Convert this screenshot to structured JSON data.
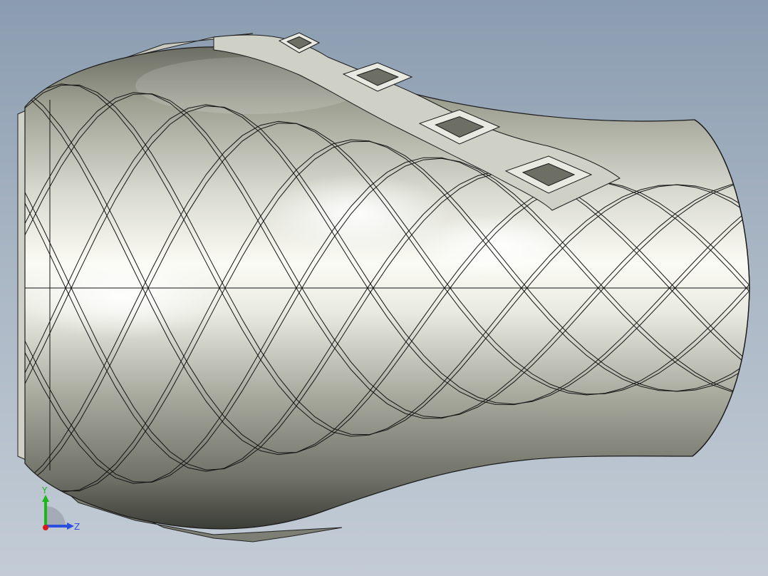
{
  "viewport": {
    "background_top": "#8a9cb0",
    "background_bottom": "#c3ccd6"
  },
  "model": {
    "surface_light": "#f4f5ee",
    "surface_mid": "#b7b9ad",
    "surface_dark": "#43453e",
    "edge_color": "#1a1a1a",
    "boss_count": 4
  },
  "triad": {
    "y_label": "Y",
    "z_label": "Z",
    "y_color": "#1fb51f",
    "z_color": "#2d4fe0",
    "x_color": "#d81c1c"
  }
}
